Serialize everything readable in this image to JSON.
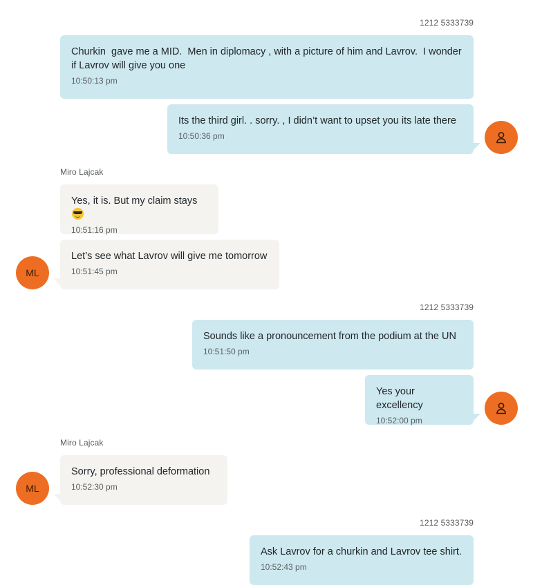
{
  "colors": {
    "outgoing_bubble": "#cde8ef",
    "incoming_bubble": "#f4f3f0",
    "avatar": "#ed6e22"
  },
  "senders": {
    "phone": "1212 5333739",
    "contact": "Miro Lajcak"
  },
  "contact_avatar_initials": "ML",
  "user_avatar_icon": "person-icon",
  "messages": [
    {
      "text": "Churkin  gave me a MID.  Men in diplomacy , with a picture of him and Lavrov.  I wonder if Lavrov will give you one",
      "time": "10:50:13 pm"
    },
    {
      "text": "Its the third girl. . sorry. , I didn’t want to upset you its late there",
      "time": "10:50:36 pm"
    },
    {
      "text": "Yes, it is. But my claim stays",
      "emoji": "smiling-face-with-sunglasses",
      "time": "10:51:16 pm"
    },
    {
      "text": "Let’s see what Lavrov will give me tomorrow",
      "time": "10:51:45 pm"
    },
    {
      "text": "Sounds like a pronouncement from the podium at the UN",
      "time": "10:51:50 pm"
    },
    {
      "text": "Yes your excellency",
      "time": "10:52:00 pm"
    },
    {
      "text": "Sorry, professional deformation",
      "time": "10:52:30 pm"
    },
    {
      "text": "Ask Lavrov for a churkin and Lavrov tee shirt.",
      "time": "10:52:43 pm"
    }
  ]
}
